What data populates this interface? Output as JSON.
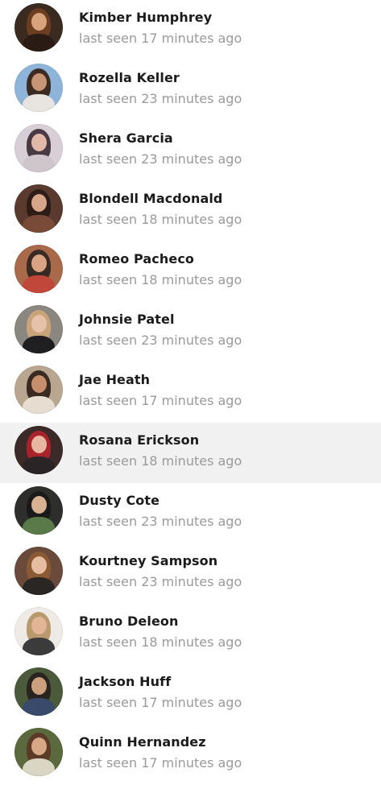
{
  "contacts": [
    {
      "name": "Kimber Humphrey",
      "status": "last seen 17 minutes ago",
      "avatar_icon": "user-photo-icon",
      "colors": {
        "bg": "#3a2a1f",
        "hair": "#6b3e22",
        "skin": "#d9a37e",
        "body": "#2a1c14"
      }
    },
    {
      "name": "Rozella Keller",
      "status": "last seen 23 minutes ago",
      "avatar_icon": "user-photo-icon",
      "colors": {
        "bg": "#8fb4d9",
        "hair": "#3b2b22",
        "skin": "#c89576",
        "body": "#e8e4df"
      }
    },
    {
      "name": "Shera Garcia",
      "status": "last seen 23 minutes ago",
      "avatar_icon": "user-photo-icon",
      "colors": {
        "bg": "#d8cfd6",
        "hair": "#4a3a44",
        "skin": "#e2b9a8",
        "body": "#cfc6cc"
      }
    },
    {
      "name": "Blondell Macdonald",
      "status": "last seen 18 minutes ago",
      "avatar_icon": "user-photo-icon",
      "colors": {
        "bg": "#5a3a2e",
        "hair": "#2e1d17",
        "skin": "#d6a58a",
        "body": "#7a4a38"
      }
    },
    {
      "name": "Romeo Pacheco",
      "status": "last seen 18 minutes ago",
      "avatar_icon": "user-photo-icon",
      "colors": {
        "bg": "#a86a4a",
        "hair": "#3a2a24",
        "skin": "#d9a384",
        "body": "#c0473a"
      }
    },
    {
      "name": "Johnsie Patel",
      "status": "last seen 23 minutes ago",
      "avatar_icon": "user-photo-icon",
      "colors": {
        "bg": "#8a8680",
        "hair": "#c9a37a",
        "skin": "#e6c2ab",
        "body": "#1f1f22"
      }
    },
    {
      "name": "Jae Heath",
      "status": "last seen 17 minutes ago",
      "avatar_icon": "user-photo-icon",
      "colors": {
        "bg": "#b9a690",
        "hair": "#3a2a22",
        "skin": "#c78e6e",
        "body": "#e6dccf"
      }
    },
    {
      "name": "Rosana Erickson",
      "status": "last seen 18 minutes ago",
      "avatar_icon": "user-photo-icon",
      "colors": {
        "bg": "#3b2a28",
        "hair": "#a8242a",
        "skin": "#e7b7a2",
        "body": "#2b2426"
      }
    },
    {
      "name": "Dusty Cote",
      "status": "last seen 23 minutes ago",
      "avatar_icon": "user-photo-icon",
      "colors": {
        "bg": "#2e2e2c",
        "hair": "#1a1a1a",
        "skin": "#d8b092",
        "body": "#5b7a4a"
      }
    },
    {
      "name": "Kourtney Sampson",
      "status": "last seen 23 minutes ago",
      "avatar_icon": "user-photo-icon",
      "colors": {
        "bg": "#6a4a3a",
        "hair": "#8a5a34",
        "skin": "#e6bda0",
        "body": "#2a2624"
      }
    },
    {
      "name": "Bruno Deleon",
      "status": "last seen 18 minutes ago",
      "avatar_icon": "user-photo-icon",
      "colors": {
        "bg": "#eeeae6",
        "hair": "#b89a6e",
        "skin": "#e2b596",
        "body": "#3b3b3b"
      }
    },
    {
      "name": "Jackson Huff",
      "status": "last seen 17 minutes ago",
      "avatar_icon": "user-photo-icon",
      "colors": {
        "bg": "#4a5a3a",
        "hair": "#2a2420",
        "skin": "#caa07e",
        "body": "#3a4a6a"
      }
    },
    {
      "name": "Quinn Hernandez",
      "status": "last seen 17 minutes ago",
      "avatar_icon": "user-photo-icon",
      "colors": {
        "bg": "#5a6a3e",
        "hair": "#5b3a28",
        "skin": "#d6a886",
        "body": "#d9d6c4"
      }
    }
  ],
  "selected_index": 7,
  "theme": {
    "selected_row_bg": "#f1f1f1",
    "name_color": "#1b1b1b",
    "status_color": "#9a9a9a"
  }
}
